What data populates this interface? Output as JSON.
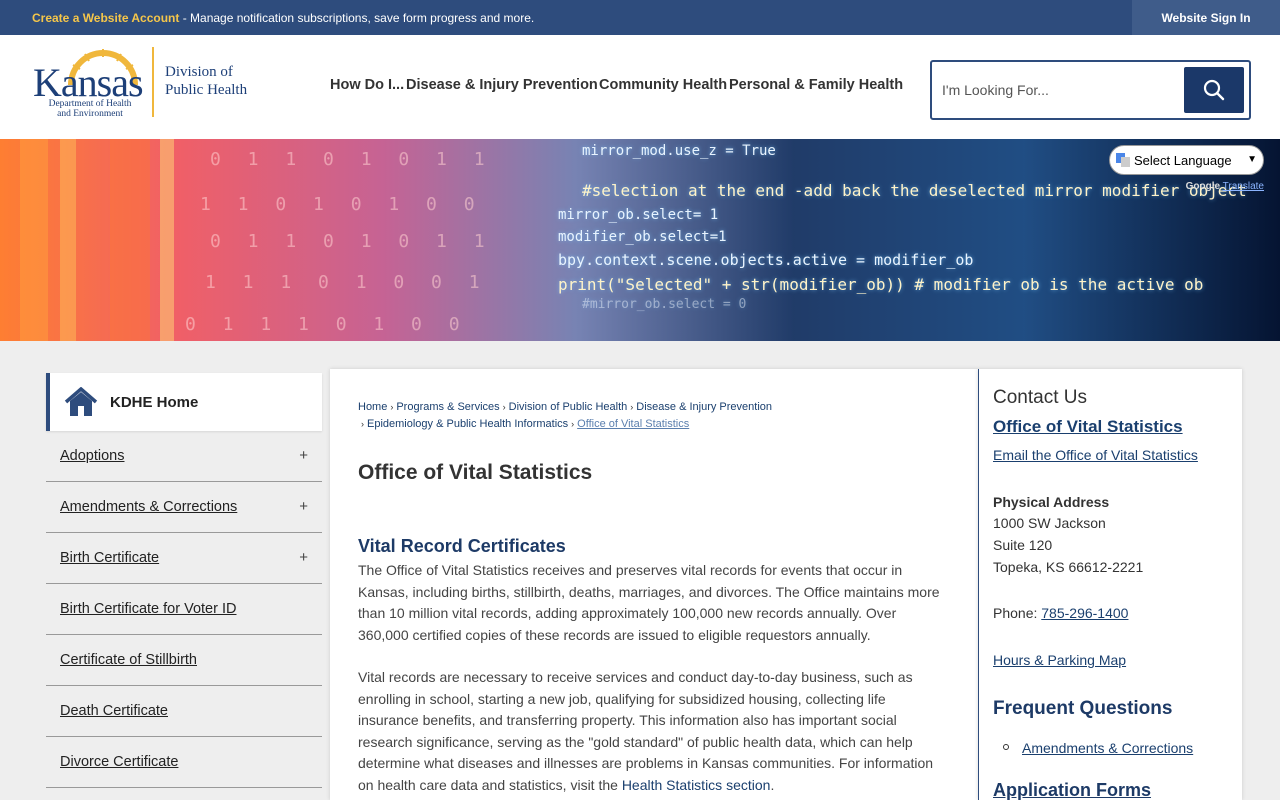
{
  "topbar": {
    "create_account": "Create a Website Account",
    "notice_rest": " - Manage notification subscriptions, save form progress and more.",
    "signin": "Website Sign In"
  },
  "logo": {
    "kansas": "Kansas",
    "dept_line1": "Department of Health",
    "dept_line2": "and Environment",
    "division_line1": "Division of",
    "division_line2": "Public Health"
  },
  "nav": [
    "How Do I...",
    "Disease & Injury Prevention",
    "Community Health",
    "Personal & Family Health"
  ],
  "search": {
    "placeholder": "I'm Looking For..."
  },
  "translate": {
    "select": "Select Language",
    "powered": "Google",
    "translate": "Translate"
  },
  "banner": {
    "code_lines": [
      "mirror_mod.use_z = True",
      "#selection at the end -add back the deselected mirror modifier object",
      "mirror_ob.select= 1",
      "modifier_ob.select=1",
      "bpy.context.scene.objects.active = modifier_ob",
      "print(\"Selected\" + str(modifier_ob)) # modifier ob is the active ob",
      "#mirror_ob.select = 0"
    ],
    "bits": [
      "0 1 1 0 1 0 1 1",
      "1 1 0 1 0 1 0 0",
      "0 1 1 0 1 0 1 1",
      "1 1 1 0 1 0 0 1",
      "0 1 1 1 0 1 0 0"
    ]
  },
  "sidebar": {
    "home": "KDHE Home",
    "items": [
      {
        "label": "Adoptions",
        "expand": "+"
      },
      {
        "label": "Amendments & Corrections",
        "expand": "+"
      },
      {
        "label": "Birth Certificate",
        "expand": "+"
      },
      {
        "label": "Birth Certificate for Voter ID",
        "expand": ""
      },
      {
        "label": "Certificate of Stillbirth",
        "expand": ""
      },
      {
        "label": "Death Certificate",
        "expand": ""
      },
      {
        "label": "Divorce Certificate",
        "expand": ""
      }
    ]
  },
  "breadcrumb": {
    "items": [
      "Home",
      "Programs & Services",
      "Division of Public Health",
      "Disease & Injury Prevention"
    ],
    "items2": [
      "Epidemiology & Public Health Informatics"
    ],
    "current": "Office of Vital Statistics",
    "sep": "›"
  },
  "main": {
    "title": "Office of Vital Statistics",
    "section_title": "Vital Record Certificates",
    "p1": "The Office of Vital Statistics receives and preserves vital records for events that occur in Kansas, including births, stillbirth, deaths, marriages, and divorces. The Office maintains more than 10 million vital records, adding approximately 100,000 new records annually. Over 360,000 certified copies of these records are issued to eligible requestors annually.",
    "p2_text": "Vital records are necessary to receive services and conduct day-to-day business, such as enrolling in school, starting a new job, qualifying for subsidized housing, collecting life insurance benefits, and transferring property. This information also has important social research significance, serving as the \"gold standard\" of public health data, which can help determine what diseases and illnesses are problems in Kansas communities. For information on health care data and statistics, visit the ",
    "p2_link": "Health Statistics section",
    "p2_end": "."
  },
  "contact": {
    "heading": "Contact Us",
    "office": "Office of Vital Statistics",
    "email": "Email the Office of Vital Statistics",
    "addr_label": "Physical Address",
    "addr1": "1000 SW Jackson",
    "addr2": "Suite 120",
    "addr3": "Topeka, KS 66612-2221",
    "phone_label": "Phone: ",
    "phone": "785-296-1400",
    "hours": "Hours & Parking Map",
    "faq_heading": "Frequent Questions",
    "faq_item": "Amendments & Corrections",
    "forms_heading": "Application Forms"
  },
  "colors": {
    "navy": "#2e4c7d",
    "gold": "#f5c64a",
    "link": "#1a3f6e"
  }
}
